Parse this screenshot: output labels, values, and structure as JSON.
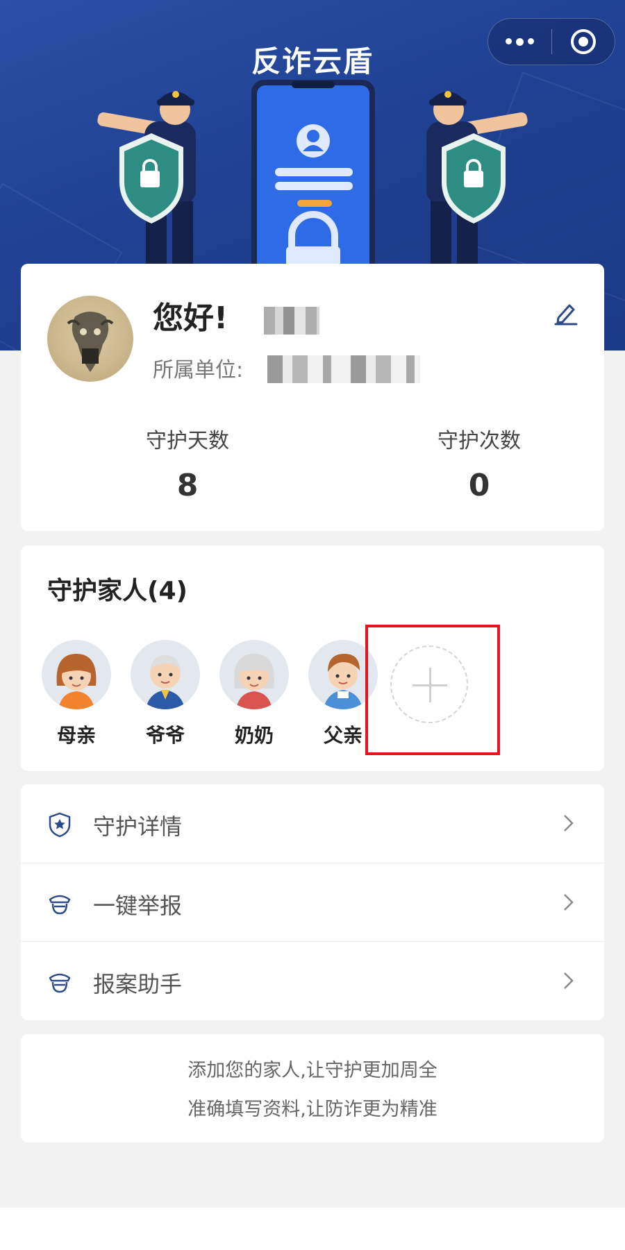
{
  "header": {
    "title": "反诈云盾",
    "more_icon": "more-dots-icon",
    "close_icon": "target-circle-icon"
  },
  "profile": {
    "greeting": "您好!",
    "unit_label": "所属单位:",
    "stats": [
      {
        "label": "守护天数",
        "value": "8"
      },
      {
        "label": "守护次数",
        "value": "0"
      }
    ]
  },
  "family": {
    "title": "守护家人(4)",
    "members": [
      {
        "name": "母亲"
      },
      {
        "name": "爷爷"
      },
      {
        "name": "奶奶"
      },
      {
        "name": "父亲"
      }
    ]
  },
  "menu": {
    "items": [
      {
        "label": "守护详情",
        "icon": "shield-star-icon"
      },
      {
        "label": "一键举报",
        "icon": "police-icon"
      },
      {
        "label": "报案助手",
        "icon": "police-icon"
      }
    ]
  },
  "tips": {
    "line1": "添加您的家人,让守护更加周全",
    "line2": "准确填写资料,让防诈更为精准"
  },
  "colors": {
    "banner": "#1f3f8f",
    "accent": "#2a4a8a",
    "highlight": "#e8141b"
  }
}
